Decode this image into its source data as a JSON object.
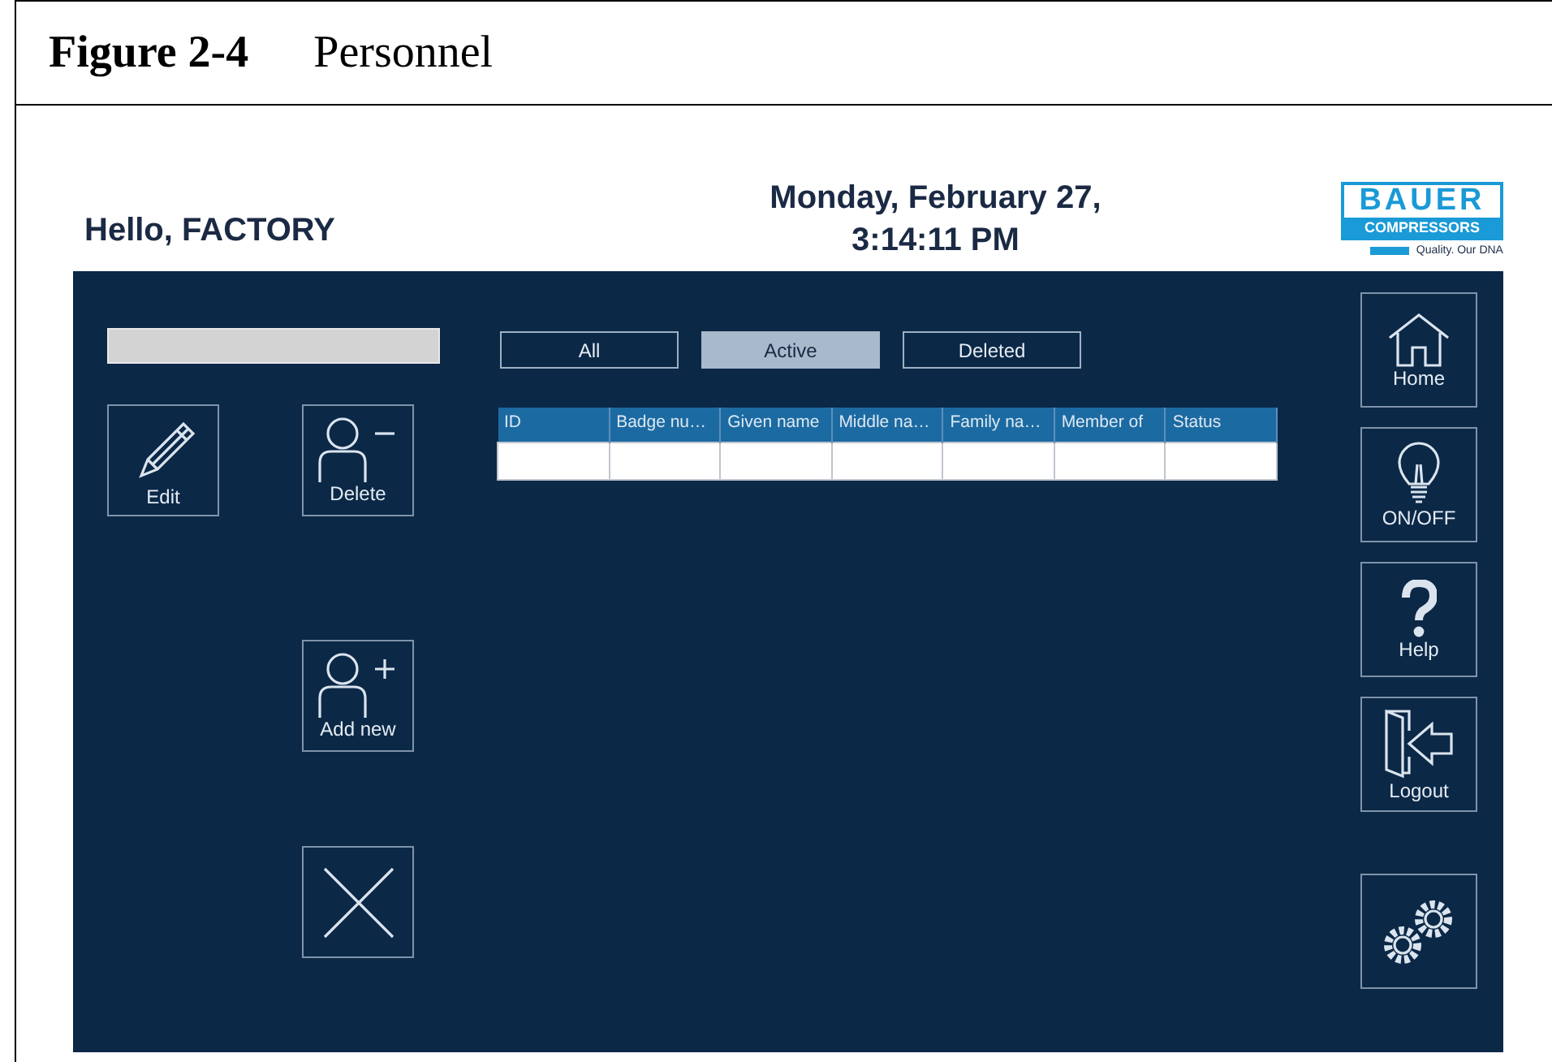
{
  "figure": {
    "label": "Figure 2-4",
    "title": "Personnel"
  },
  "header": {
    "greeting": "Hello, FACTORY",
    "date": "Monday, February 27,",
    "time": "3:14:11 PM",
    "logo": {
      "name": "BAUER",
      "subtitle": "COMPRESSORS",
      "tagline": "Quality. Our DNA"
    }
  },
  "actions": [
    {
      "kind": "edit",
      "label": "Edit"
    },
    {
      "kind": "delete",
      "label": "Delete"
    },
    {
      "kind": "add",
      "label": "Add new"
    },
    {
      "kind": "close"
    }
  ],
  "filters": [
    {
      "label": "All",
      "selected": false
    },
    {
      "label": "Active",
      "selected": true
    },
    {
      "label": "Deleted",
      "selected": false
    }
  ],
  "table": {
    "columns": [
      "ID",
      "Badge nu…",
      "Given name",
      "Middle na…",
      "Family na…",
      "Member of",
      "Status"
    ]
  },
  "nav": [
    {
      "kind": "home",
      "label": "Home"
    },
    {
      "kind": "power",
      "label": "ON/OFF"
    },
    {
      "kind": "help",
      "label": "Help"
    },
    {
      "kind": "logout",
      "label": "Logout"
    },
    {
      "kind": "settings"
    }
  ]
}
